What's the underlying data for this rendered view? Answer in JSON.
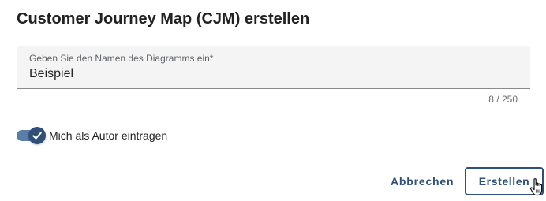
{
  "dialog": {
    "title": "Customer Journey Map (CJM) erstellen",
    "name_field": {
      "label": "Geben Sie den Namen des Diagramms ein*",
      "value": "Beispiel",
      "counter": "8 / 250"
    },
    "author_toggle": {
      "label": "Mich als Autor eintragen",
      "checked": true,
      "icon": "check-icon"
    },
    "actions": {
      "cancel_label": "Abbrechen",
      "create_label": "Erstellen"
    }
  },
  "colors": {
    "primary": "#2e5079",
    "toggle_track": "#5b7ea6",
    "field_background": "#f4f4f4"
  }
}
